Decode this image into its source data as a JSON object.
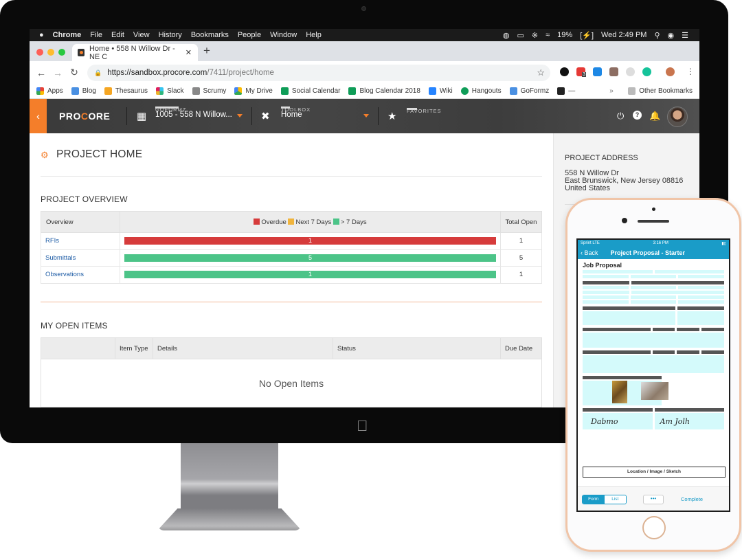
{
  "macos": {
    "menubar": {
      "apple": "",
      "app": "Chrome",
      "menus": [
        "File",
        "Edit",
        "View",
        "History",
        "Bookmarks",
        "People",
        "Window",
        "Help"
      ],
      "battery": "19%",
      "clock": "Wed 2:49 PM"
    }
  },
  "browser": {
    "tab_title": "Home • 558 N Willow Dr - NE C",
    "new_tab": "+",
    "url_host": "https://sandbox.procore.com",
    "url_path": "/7411/project/home",
    "extension_badge": "3",
    "bookmarks": [
      {
        "label": "Apps",
        "color": "#e94235"
      },
      {
        "label": "Blog",
        "color": "#4a90e2"
      },
      {
        "label": "Thesaurus",
        "color": "#f5a623"
      },
      {
        "label": "Slack",
        "color": "#36c5f0"
      },
      {
        "label": "Scrumy",
        "color": "#888888"
      },
      {
        "label": "My Drive",
        "color": "#34a853"
      },
      {
        "label": "Social Calendar",
        "color": "#0f9d58"
      },
      {
        "label": "Blog Calendar 2018",
        "color": "#0f9d58"
      },
      {
        "label": "Wiki",
        "color": "#2684ff"
      },
      {
        "label": "Hangouts",
        "color": "#0f9d58"
      },
      {
        "label": "GoFormz",
        "color": "#4a90e2"
      },
      {
        "label": "—",
        "color": "#222222"
      }
    ],
    "overflow": "»",
    "other_bookmarks": "Other Bookmarks"
  },
  "procore": {
    "logo_pre": "PRO",
    "logo_dot": "C",
    "logo_post": "ORE",
    "company_label": "GOFORMZ",
    "project_value": "1005 - 558 N Willow...",
    "toolbox_label": "TOOLBOX",
    "toolbox_value": "Home",
    "favorites_label": "FAVORITES",
    "page_title": "PROJECT HOME",
    "overview": {
      "title": "PROJECT OVERVIEW",
      "headers": {
        "overview": "Overview",
        "total": "Total Open"
      },
      "legend": [
        {
          "label": "Overdue",
          "color": "#d63b3b"
        },
        {
          "label": "Next 7 Days",
          "color": "#f0b43c"
        },
        {
          "label": "> 7 Days",
          "color": "#4cc488"
        }
      ],
      "rows": [
        {
          "name": "RFIs",
          "bar_value": "1",
          "bar_color": "#d63b3b",
          "total": "1"
        },
        {
          "name": "Submittals",
          "bar_value": "5",
          "bar_color": "#4cc488",
          "total": "5"
        },
        {
          "name": "Observations",
          "bar_value": "1",
          "bar_color": "#4cc488",
          "total": "1"
        }
      ]
    },
    "open_items": {
      "title": "MY OPEN ITEMS",
      "headers": [
        "",
        "Item Type",
        "Details",
        "Status",
        "Due Date"
      ],
      "empty": "No Open Items"
    },
    "side": {
      "title": "PROJECT ADDRESS",
      "line1": "558 N Willow Dr",
      "line2": "East Brunswick, New Jersey 08816",
      "line3": "United States"
    }
  },
  "phone": {
    "carrier": "Sprint  LTE",
    "time": "3:16 PM",
    "back": "Back",
    "title": "Project Proposal - Starter",
    "form_heading": "Job Proposal",
    "signature1": "Dabmo",
    "signature2": "Am Jolh",
    "location_box": "Location / Image / Sketch",
    "seg_form": "Form",
    "seg_list": "List",
    "more": "•••",
    "complete": "Complete"
  }
}
